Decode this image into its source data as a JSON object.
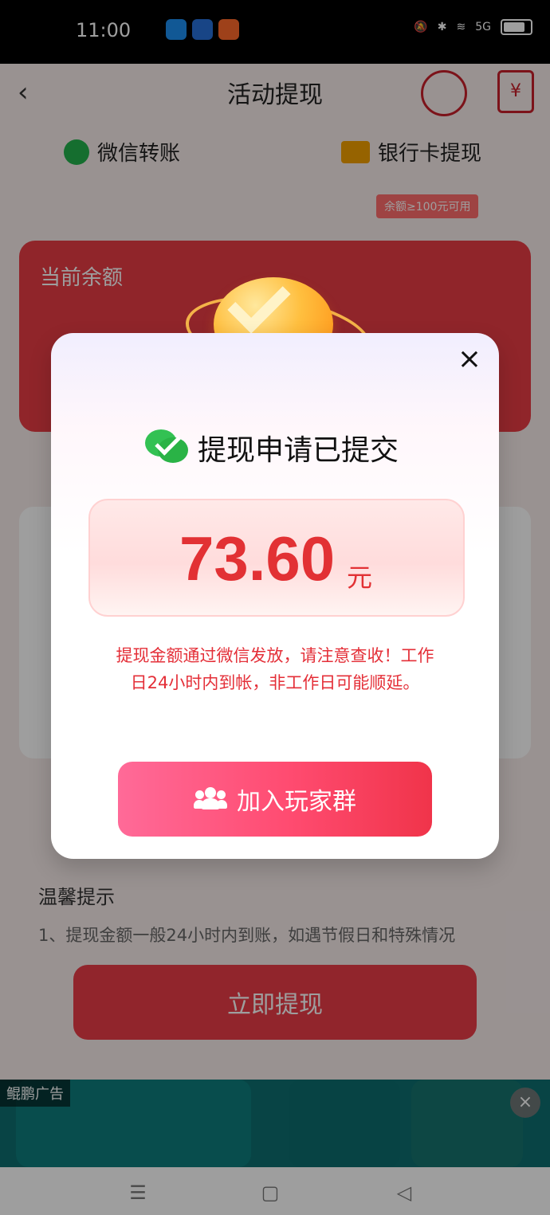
{
  "status_bar": {
    "time": "11:00",
    "network": "5G"
  },
  "header": {
    "title": "活动提现",
    "back_icon": "chevron-left-icon",
    "support_icon": "support-icon",
    "wallet_icon": "wallet-icon",
    "wallet_symbol": "¥"
  },
  "tabs": {
    "wechat": "微信转账",
    "bank": "银行卡提现",
    "bank_badge": "余额≥100元可用"
  },
  "background": {
    "balance_title": "当前余额",
    "tips_title": "温馨提示",
    "tips_text": "1、提现金额一般24小时内到账，如遇节假日和特殊情况",
    "withdraw_button": "立即提现"
  },
  "modal": {
    "title": "提现申请已提交",
    "amount": "73.60",
    "unit": "元",
    "notice_line1": "提现金额通过微信发放，请注意查收！工作",
    "notice_line2": "日24小时内到帐，非工作日可能顺延。",
    "join_button": "加入玩家群",
    "close_icon": "close-icon",
    "coin_icon": "coin-check-icon"
  },
  "ad": {
    "label": "鲲鹏广告",
    "close_icon": "close-icon"
  },
  "navigation": {
    "menu_icon": "menu-icon",
    "home_icon": "home-icon",
    "back_icon": "back-triangle-icon"
  }
}
